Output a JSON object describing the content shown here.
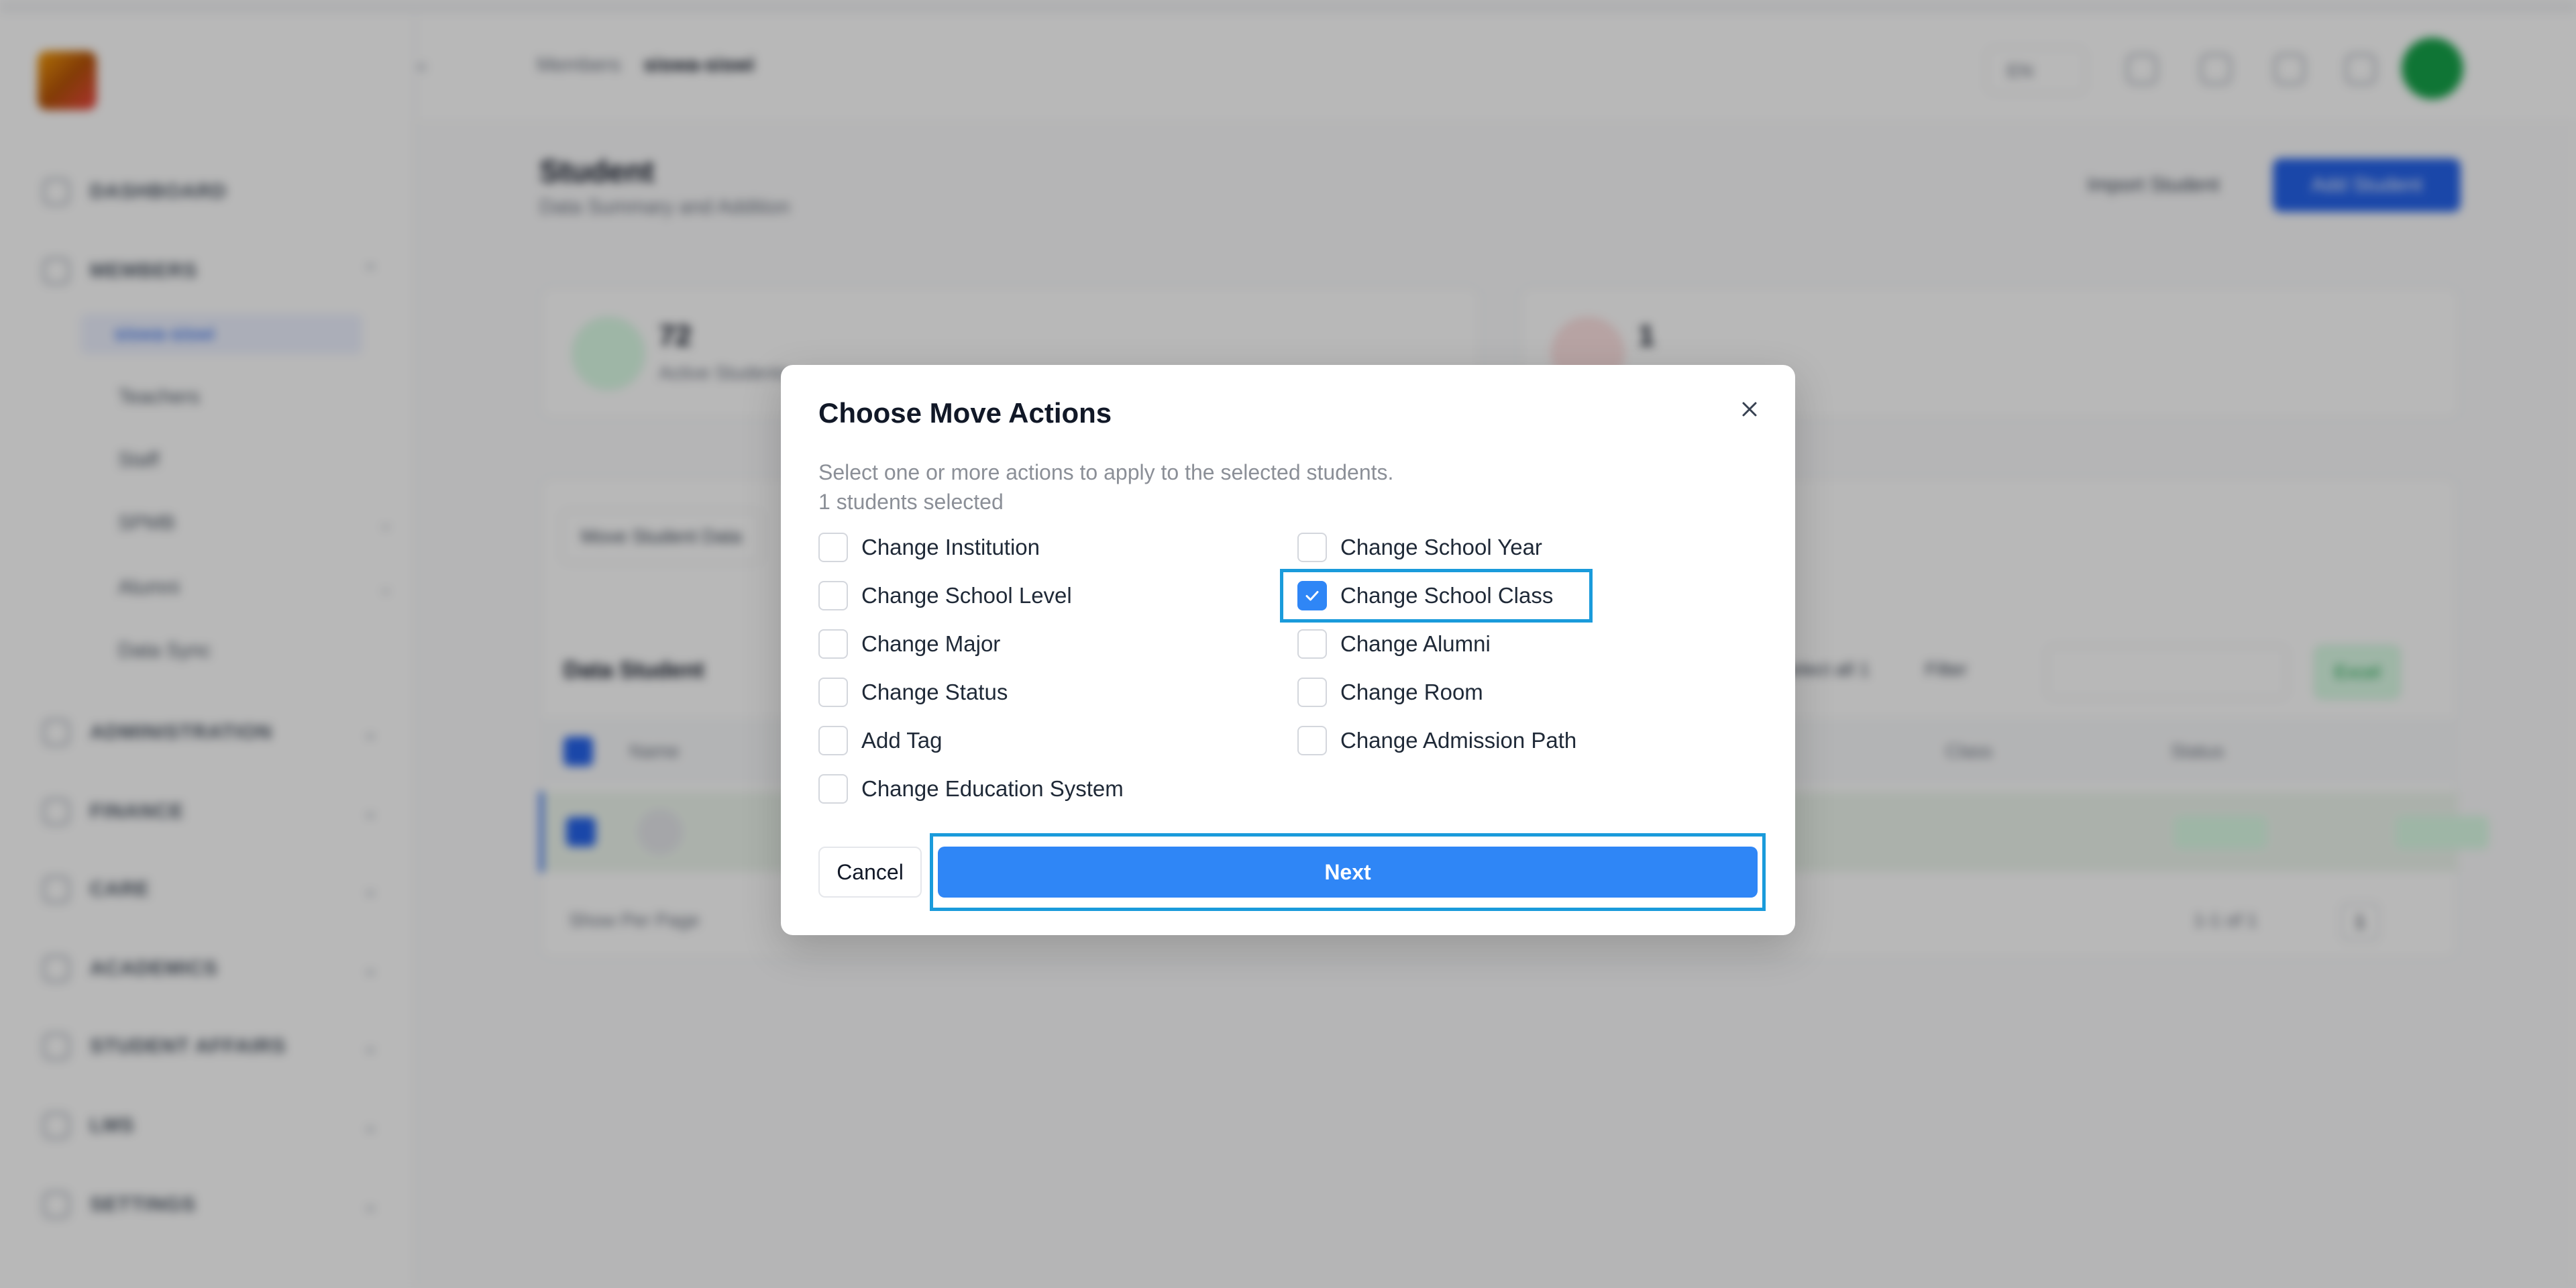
{
  "sidebar": {
    "nav": [
      {
        "label": "DASHBOARD"
      },
      {
        "label": "MEMBERS"
      },
      {
        "label": "ADMINISTRATION"
      },
      {
        "label": "FINANCE"
      },
      {
        "label": "CARE"
      },
      {
        "label": "ACADEMICS"
      },
      {
        "label": "STUDENT AFFAIRS"
      },
      {
        "label": "LMS"
      },
      {
        "label": "SETTINGS"
      }
    ],
    "members_sub": [
      {
        "label": "siswa-siswi"
      },
      {
        "label": "Teachers"
      },
      {
        "label": "Staff"
      },
      {
        "label": "SPMB"
      },
      {
        "label": "Alumni"
      },
      {
        "label": "Data Sync"
      }
    ]
  },
  "header": {
    "breadcrumb_parent": "Members",
    "breadcrumb_current": "siswa-siswi",
    "lang": "EN"
  },
  "page": {
    "title": "Student",
    "subtitle": "Data Summary and Addition",
    "import_label": "Import Student",
    "add_label": "Add Student"
  },
  "stats": [
    {
      "value": "72",
      "label": "Active Students"
    },
    {
      "value": "1",
      "label": ""
    }
  ],
  "table": {
    "move_button": "Move Student Data",
    "title": "Data Student",
    "select_all": "Select all 1",
    "filter": "Filter",
    "export": "Excel",
    "columns": [
      "Name",
      "Class",
      "Status"
    ],
    "rows_per_page": "Show Per Page",
    "pagination": "1-1 of 1",
    "page": "1"
  },
  "modal": {
    "title": "Choose Move Actions",
    "description": "Select one or more actions to apply to the selected students.",
    "selected_count": "1 students selected",
    "left_options": [
      {
        "label": "Change Institution",
        "checked": false
      },
      {
        "label": "Change School Level",
        "checked": false
      },
      {
        "label": "Change Major",
        "checked": false
      },
      {
        "label": "Change Status",
        "checked": false
      },
      {
        "label": "Add Tag",
        "checked": false
      },
      {
        "label": "Change Education System",
        "checked": false
      }
    ],
    "right_options": [
      {
        "label": "Change School Year",
        "checked": false
      },
      {
        "label": "Change School Class",
        "checked": true
      },
      {
        "label": "Change Alumni",
        "checked": false
      },
      {
        "label": "Change Room",
        "checked": false
      },
      {
        "label": "Change Admission Path",
        "checked": false
      }
    ],
    "cancel_label": "Cancel",
    "next_label": "Next"
  },
  "colors": {
    "accent": "#2f86f6",
    "highlight": "#1a9bdb"
  }
}
